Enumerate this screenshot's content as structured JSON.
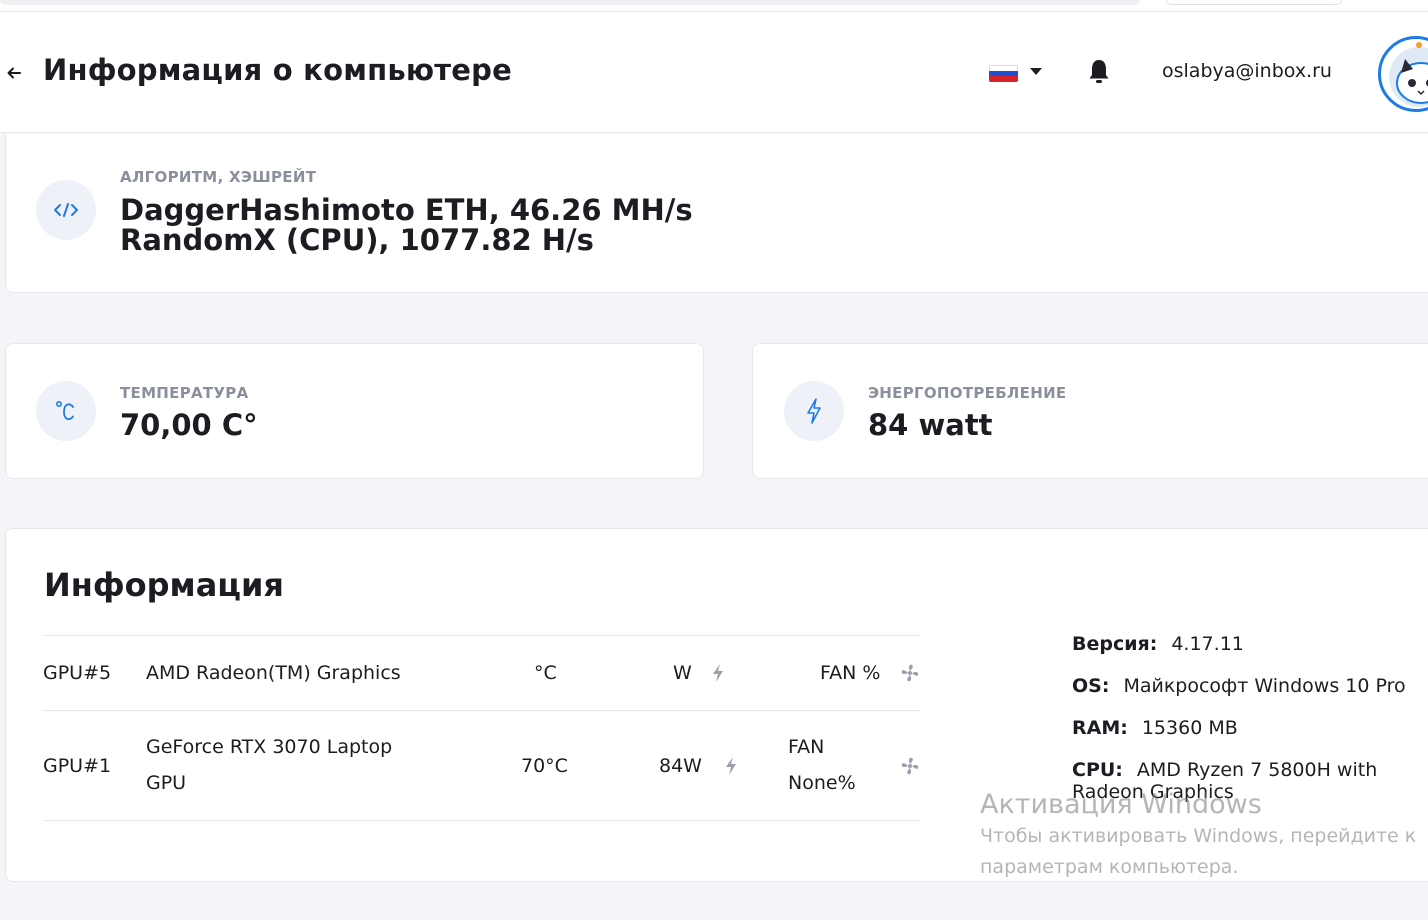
{
  "header": {
    "title": "Информация о компьютере",
    "email": "oslabya@inbox.ru",
    "language_flag": "russian-flag",
    "flag_colors": [
      "#ffffff",
      "#1f4fd1",
      "#d6222a"
    ]
  },
  "algorithm": {
    "label": "АЛГОРИТМ, ХЭШРЕЙТ",
    "lines": [
      "DaggerHashimoto ETH, 46.26 MH/s",
      "RandomX (CPU), 1077.82 H/s"
    ],
    "icon": "code-icon"
  },
  "temperature": {
    "label": "ТЕМПЕРАТУРА",
    "value": "70,00 C°",
    "icon": "celsius-icon"
  },
  "power": {
    "label": "ЭНЕРГОПОТРЕБЛЕНИЕ",
    "value": "84 watt",
    "icon": "lightning-icon"
  },
  "info": {
    "title": "Информация",
    "gpus": [
      {
        "id": "GPU#5",
        "name": "AMD Radeon(TM) Graphics",
        "temp": "°C",
        "power": "W",
        "fan_line1": "FAN %",
        "fan_line2": ""
      },
      {
        "id": "GPU#1",
        "name_line1": "GeForce RTX 3070 Laptop",
        "name_line2": "GPU",
        "temp": "70°C",
        "power": "84W",
        "fan_line1": "FAN",
        "fan_line2": "None%"
      }
    ],
    "system": {
      "version_key": "Версия:",
      "version_value": "4.17.11",
      "os_key": "OS:",
      "os_value": "Майкрософт Windows 10 Pro",
      "ram_key": "RAM:",
      "ram_value": "15360 MB",
      "cpu_key": "CPU:",
      "cpu_value": "AMD Ryzen 7 5800H with Radeon Graphics"
    }
  },
  "watermark": {
    "title": "Активация Windows",
    "line1": "Чтобы активировать Windows, перейдите к",
    "line2": "параметрам компьютера."
  },
  "colors": {
    "accent": "#1e7be6",
    "icon_bg": "#eef1f8",
    "label": "#8a8f9c"
  }
}
